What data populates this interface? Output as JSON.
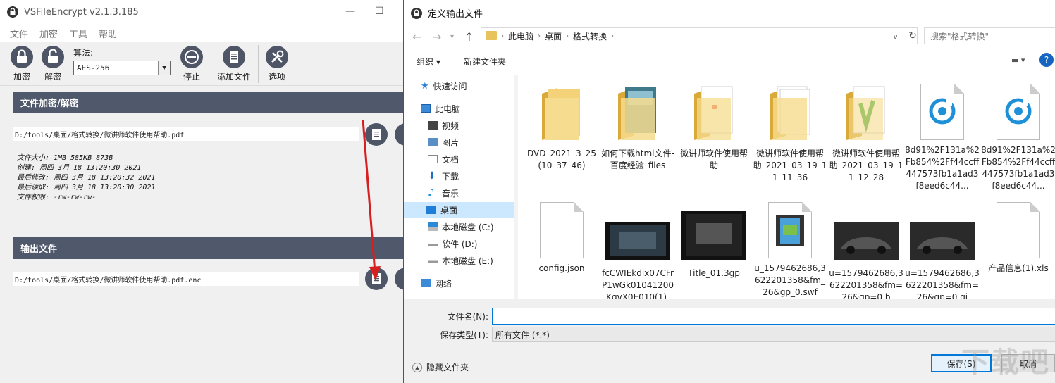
{
  "app": {
    "title": "VSFileEncrypt v2.1.3.185",
    "menu": [
      "文件",
      "加密",
      "工具",
      "帮助"
    ],
    "toolbar": {
      "encrypt": "加密",
      "decrypt": "解密",
      "algo_label": "算法:",
      "algo_value": "AES-256",
      "stop": "停止",
      "add_file": "添加文件",
      "options": "选项"
    },
    "section_encrypt": "文件加密/解密",
    "input_path": "D:/tools/桌面/格式转换/微讲师软件使用帮助.pdf",
    "info_lines": [
      "文件大小: 1MB 585KB 873B",
      "创建: 周四 3月 18 13:20:30 2021",
      "最后修改: 周四 3月 18 13:20:32 2021",
      "最后读取: 周四 3月 18 13:20:30 2021",
      "文件权限: -rw-rw-rw-"
    ],
    "section_output": "输出文件",
    "output_path": "D:/tools/桌面/格式转换/微讲师软件使用帮助.pdf.enc"
  },
  "dialog": {
    "title": "定义输出文件",
    "breadcrumb": [
      "此电脑",
      "桌面",
      "格式转换"
    ],
    "search_placeholder": "搜索\"格式转换\"",
    "organize": "组织",
    "new_folder": "新建文件夹",
    "help": "?",
    "nav": {
      "quick_access": "快速访问",
      "this_pc": "此电脑",
      "videos": "视频",
      "pictures": "图片",
      "documents": "文档",
      "downloads": "下载",
      "music": "音乐",
      "desktop": "桌面",
      "disk_c": "本地磁盘 (C:)",
      "disk_d": "软件 (D:)",
      "disk_e": "本地磁盘 (E:)",
      "network": "网络"
    },
    "files": [
      "DVD_2021_3_25 (10_37_46)",
      "如何下载html文件-百度经验_files",
      "微讲师软件使用帮助",
      "微讲师软件使用帮助_2021_03_19_11_11_36",
      "微讲师软件使用帮助_2021_03_19_11_12_28",
      "8d91%2F131a%2Fb854%2Ff44ccff447573fb1a1ad3f8eed6c44...",
      "8d91%2F131a%2Fb854%2Ff44ccff447573fb1a1ad3f8eed6c44...",
      "config.json",
      "fcCWIEkdlx07CFrP1wGk01041200KqvX0E010(1).",
      "Title_01.3gp",
      "u_1579462686,3622201358&fm_26&gp_0.swf",
      "u=1579462686,3622201358&fm=26&gp=0.b",
      "u=1579462686,3622201358&fm=26&gp=0.gi",
      "产品信息(1).xls"
    ],
    "filename_label": "文件名(N):",
    "filename_value": "",
    "filetype_label": "保存类型(T):",
    "filetype_value": "所有文件 (*.*)",
    "hide_folders": "隐藏文件夹",
    "save": "保存(S)",
    "cancel": "取消"
  },
  "watermark": "下载吧",
  "colors": {
    "section_header": "#50596c",
    "accent": "#0078d7",
    "folder": "#e8c25c",
    "arrow": "#d62020"
  }
}
